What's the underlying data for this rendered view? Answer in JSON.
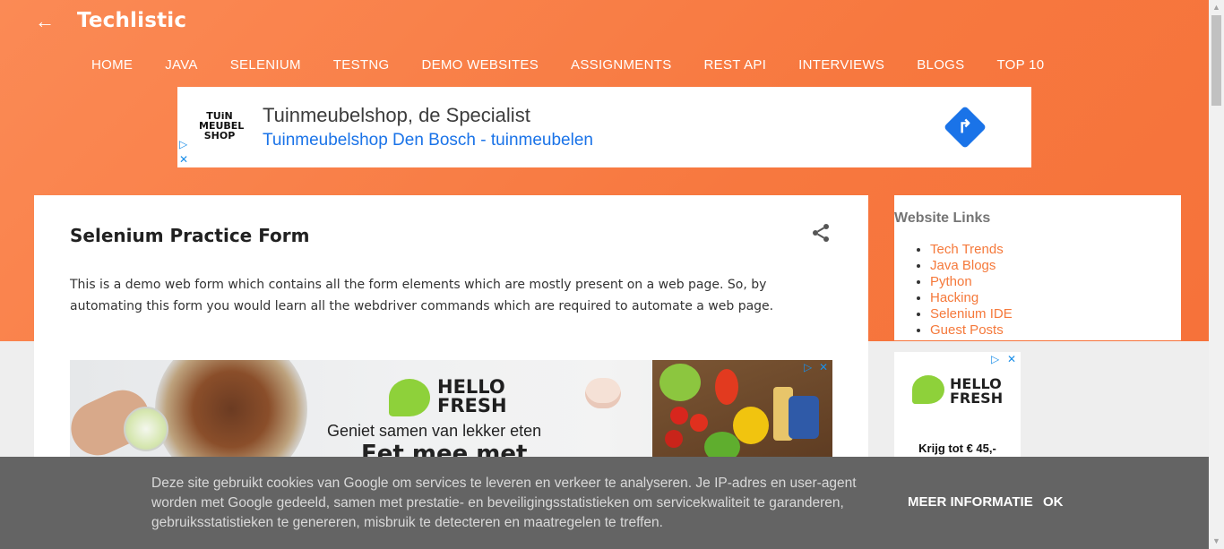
{
  "brand": {
    "title": "Techlistic",
    "back_icon": "←"
  },
  "nav": {
    "items": [
      "HOME",
      "JAVA",
      "SELENIUM",
      "TESTNG",
      "DEMO WEBSITES",
      "ASSIGNMENTS",
      "REST API",
      "INTERVIEWS",
      "BLOGS",
      "TOP 10"
    ]
  },
  "ad_top": {
    "logo_lines": [
      "TUiN",
      "MEUBEL",
      "SHOP"
    ],
    "headline": "Tuinmeubelshop, de Specialist",
    "subline": "Tuinmeubelshop Den Bosch - tuinmeubelen",
    "arrow_icon": "↱",
    "adchoices_icon": "▷",
    "close_icon": "✕"
  },
  "post": {
    "title": "Selenium Practice Form",
    "intro": "This is a demo web form which contains all the form elements which are mostly present on a web page. So, by automating this form you would learn all the webdriver commands which are required to automate a web page."
  },
  "ad_hellofresh": {
    "logo_lines": [
      "HELLO",
      "FRESH"
    ],
    "tagline": "Geniet samen van lekker eten",
    "tagline2": "Eet mee met",
    "adchoices_icon": "▷",
    "close_icon": "✕"
  },
  "sidebar": {
    "title": "Website Links",
    "links": [
      "Tech Trends",
      "Java Blogs",
      "Python",
      "Hacking",
      "Selenium IDE",
      "Guest Posts"
    ],
    "ad": {
      "logo_lines": [
        "HELLO",
        "FRESH"
      ],
      "promo": "Krijg tot € 45,-",
      "adchoices_icon": "▷",
      "close_icon": "✕"
    }
  },
  "cookie": {
    "text": "Deze site gebruikt cookies van Google om services te leveren en verkeer te analyseren. Je IP-adres en user-agent worden met Google gedeeld, samen met prestatie- en beveiligingsstatistieken om servicekwaliteit te garanderen, gebruiksstatistieken te genereren, misbruik te detecteren en maatregelen te treffen.",
    "more_label": "MEER INFORMATIE",
    "ok_label": "OK"
  },
  "colors": {
    "header_orange": "#f7783f",
    "link_orange": "#f5793b",
    "ad_blue": "#1a73e8",
    "cookie_bg": "#646464"
  }
}
